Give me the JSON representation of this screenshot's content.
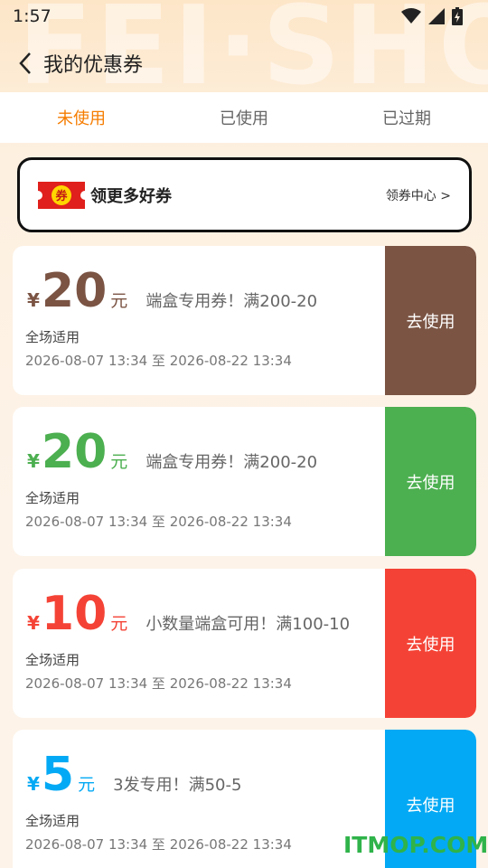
{
  "status": {
    "time": "1:57"
  },
  "header": {
    "title": "我的优惠券"
  },
  "tabs": [
    {
      "label": "未使用"
    },
    {
      "label": "已使用"
    },
    {
      "label": "已过期"
    }
  ],
  "promo": {
    "badge_text": "券",
    "title": "领更多好券",
    "link": "领券中心 >"
  },
  "coupons": [
    {
      "yen": "¥",
      "amount": "20",
      "unit": "元",
      "desc": "端盒专用券！满200-20",
      "scope": "全场适用",
      "dates": "2026-08-07 13:34 至 2026-08-22 13:34",
      "button": "去使用",
      "color": "#7b5444"
    },
    {
      "yen": "¥",
      "amount": "20",
      "unit": "元",
      "desc": "端盒专用券！满200-20",
      "scope": "全场适用",
      "dates": "2026-08-07 13:34 至 2026-08-22 13:34",
      "button": "去使用",
      "color": "#4caf50"
    },
    {
      "yen": "¥",
      "amount": "10",
      "unit": "元",
      "desc": "小数量端盒可用！满100-10",
      "scope": "全场适用",
      "dates": "2026-08-07 13:34 至 2026-08-22 13:34",
      "button": "去使用",
      "color": "#f44336"
    },
    {
      "yen": "¥",
      "amount": "5",
      "unit": "元",
      "desc": "3发专用！满50-5",
      "scope": "全场适用",
      "dates": "2026-08-07 13:34 至 2026-08-22 13:34",
      "button": "去使用",
      "color": "#03a9f4"
    }
  ],
  "watermark": "ITMOP.COM",
  "background_text": "FEI·SHO"
}
